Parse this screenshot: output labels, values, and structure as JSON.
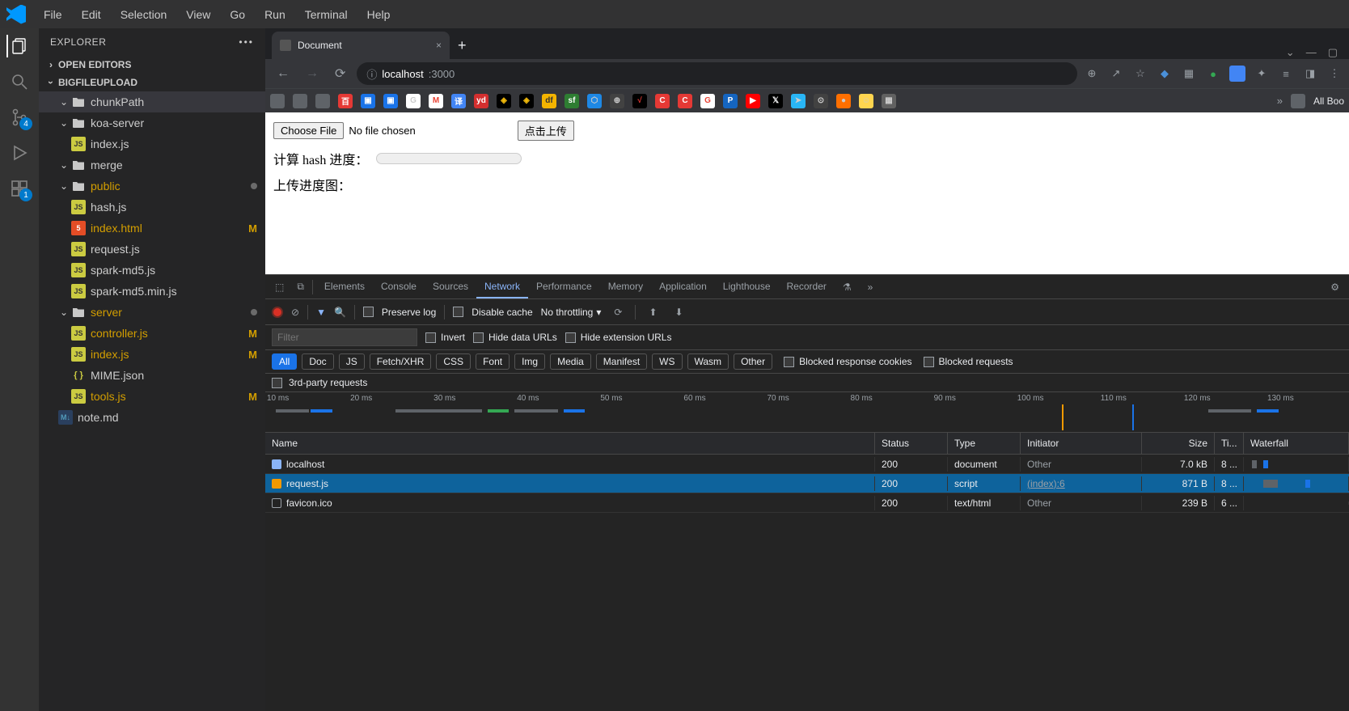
{
  "menu": [
    "File",
    "Edit",
    "Selection",
    "View",
    "Go",
    "Run",
    "Terminal",
    "Help"
  ],
  "activity_badges": {
    "scm": "4",
    "ext": "1"
  },
  "explorer": {
    "title": "EXPLORER",
    "open_editors": "OPEN EDITORS",
    "project": "BIGFILEUPLOAD",
    "tree": [
      {
        "depth": 1,
        "type": "folder",
        "name": "chunkPath",
        "open": true,
        "selected": true
      },
      {
        "depth": 1,
        "type": "folder",
        "name": "koa-server",
        "open": true
      },
      {
        "depth": 2,
        "type": "js",
        "name": "index.js"
      },
      {
        "depth": 1,
        "type": "folder",
        "name": "merge",
        "open": true
      },
      {
        "depth": 1,
        "type": "folder",
        "name": "public",
        "open": true,
        "dot": true,
        "modified": true
      },
      {
        "depth": 2,
        "type": "js",
        "name": "hash.js"
      },
      {
        "depth": 2,
        "type": "html",
        "name": "index.html",
        "m": true,
        "modified": true
      },
      {
        "depth": 2,
        "type": "js",
        "name": "request.js"
      },
      {
        "depth": 2,
        "type": "js",
        "name": "spark-md5.js"
      },
      {
        "depth": 2,
        "type": "js",
        "name": "spark-md5.min.js"
      },
      {
        "depth": 1,
        "type": "folder",
        "name": "server",
        "open": true,
        "dot": true,
        "modified": true
      },
      {
        "depth": 2,
        "type": "js",
        "name": "controller.js",
        "m": true,
        "modified": true
      },
      {
        "depth": 2,
        "type": "js",
        "name": "index.js",
        "m": true,
        "modified": true
      },
      {
        "depth": 2,
        "type": "json",
        "name": "MIME.json"
      },
      {
        "depth": 2,
        "type": "js",
        "name": "tools.js",
        "m": true,
        "modified": true
      },
      {
        "depth": 1,
        "type": "md",
        "name": "note.md"
      }
    ]
  },
  "chrome": {
    "tab_title": "Document",
    "url_domain": "localhost",
    "url_port": ":3000",
    "bookmarks_more": "»",
    "bookmarks_allbk": "All Boo",
    "page": {
      "choose_file": "Choose File",
      "no_file": "No file chosen",
      "upload_btn": "点击上传",
      "hash_label": "计算 hash 进度：",
      "upload_label": "上传进度图："
    }
  },
  "devtools": {
    "tabs": [
      "Elements",
      "Console",
      "Sources",
      "Network",
      "Performance",
      "Memory",
      "Application",
      "Lighthouse",
      "Recorder"
    ],
    "active_tab": "Network",
    "preserve_log": "Preserve log",
    "disable_cache": "Disable cache",
    "throttle": "No throttling",
    "filter_placeholder": "Filter",
    "invert": "Invert",
    "hide_data_urls": "Hide data URLs",
    "hide_ext_urls": "Hide extension URLs",
    "types": [
      "All",
      "Doc",
      "JS",
      "Fetch/XHR",
      "CSS",
      "Font",
      "Img",
      "Media",
      "Manifest",
      "WS",
      "Wasm",
      "Other"
    ],
    "active_type": "All",
    "blocked_resp": "Blocked response cookies",
    "blocked_req": "Blocked requests",
    "third_party": "3rd-party requests",
    "timeline": [
      "10 ms",
      "20 ms",
      "30 ms",
      "40 ms",
      "50 ms",
      "60 ms",
      "70 ms",
      "80 ms",
      "90 ms",
      "100 ms",
      "110 ms",
      "120 ms",
      "130 ms"
    ],
    "columns": [
      "Name",
      "Status",
      "Type",
      "Initiator",
      "Size",
      "Ti...",
      "Waterfall"
    ],
    "rows": [
      {
        "icon": "doc",
        "name": "localhost",
        "status": "200",
        "type": "document",
        "initiator": "Other",
        "initiator_dim": true,
        "size": "7.0 kB",
        "time": "8 ...",
        "wf": [
          {
            "l": 2,
            "w": 6,
            "c": "queue"
          },
          {
            "l": 8,
            "w": 6,
            "c": "dl"
          }
        ]
      },
      {
        "icon": "js",
        "name": "request.js",
        "status": "200",
        "type": "script",
        "initiator": "(index):6",
        "initiator_dim": false,
        "size": "871 B",
        "time": "8 ...",
        "wf": [
          {
            "l": 16,
            "w": 18,
            "c": "queue"
          },
          {
            "l": 34,
            "w": 6,
            "c": "dl"
          }
        ]
      },
      {
        "icon": "other",
        "name": "favicon.ico",
        "status": "200",
        "type": "text/html",
        "initiator": "Other",
        "initiator_dim": true,
        "size": "239 B",
        "time": "6 ...",
        "wf": []
      }
    ]
  }
}
